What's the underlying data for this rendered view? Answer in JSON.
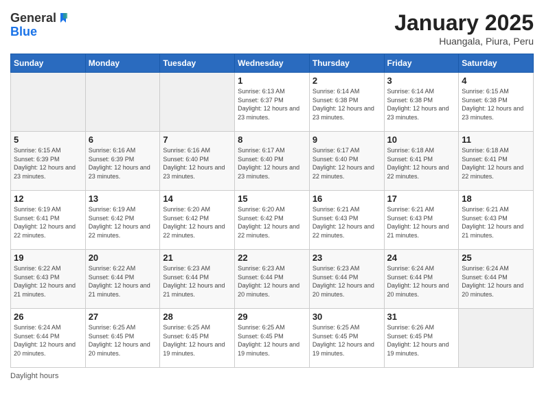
{
  "header": {
    "logo_general": "General",
    "logo_blue": "Blue",
    "title": "January 2025",
    "location": "Huangala, Piura, Peru"
  },
  "days_of_week": [
    "Sunday",
    "Monday",
    "Tuesday",
    "Wednesday",
    "Thursday",
    "Friday",
    "Saturday"
  ],
  "weeks": [
    [
      {
        "day": null,
        "sunrise": null,
        "sunset": null,
        "daylight": null
      },
      {
        "day": null,
        "sunrise": null,
        "sunset": null,
        "daylight": null
      },
      {
        "day": null,
        "sunrise": null,
        "sunset": null,
        "daylight": null
      },
      {
        "day": "1",
        "sunrise": "6:13 AM",
        "sunset": "6:37 PM",
        "daylight": "12 hours and 23 minutes."
      },
      {
        "day": "2",
        "sunrise": "6:14 AM",
        "sunset": "6:38 PM",
        "daylight": "12 hours and 23 minutes."
      },
      {
        "day": "3",
        "sunrise": "6:14 AM",
        "sunset": "6:38 PM",
        "daylight": "12 hours and 23 minutes."
      },
      {
        "day": "4",
        "sunrise": "6:15 AM",
        "sunset": "6:38 PM",
        "daylight": "12 hours and 23 minutes."
      }
    ],
    [
      {
        "day": "5",
        "sunrise": "6:15 AM",
        "sunset": "6:39 PM",
        "daylight": "12 hours and 23 minutes."
      },
      {
        "day": "6",
        "sunrise": "6:16 AM",
        "sunset": "6:39 PM",
        "daylight": "12 hours and 23 minutes."
      },
      {
        "day": "7",
        "sunrise": "6:16 AM",
        "sunset": "6:40 PM",
        "daylight": "12 hours and 23 minutes."
      },
      {
        "day": "8",
        "sunrise": "6:17 AM",
        "sunset": "6:40 PM",
        "daylight": "12 hours and 23 minutes."
      },
      {
        "day": "9",
        "sunrise": "6:17 AM",
        "sunset": "6:40 PM",
        "daylight": "12 hours and 22 minutes."
      },
      {
        "day": "10",
        "sunrise": "6:18 AM",
        "sunset": "6:41 PM",
        "daylight": "12 hours and 22 minutes."
      },
      {
        "day": "11",
        "sunrise": "6:18 AM",
        "sunset": "6:41 PM",
        "daylight": "12 hours and 22 minutes."
      }
    ],
    [
      {
        "day": "12",
        "sunrise": "6:19 AM",
        "sunset": "6:41 PM",
        "daylight": "12 hours and 22 minutes."
      },
      {
        "day": "13",
        "sunrise": "6:19 AM",
        "sunset": "6:42 PM",
        "daylight": "12 hours and 22 minutes."
      },
      {
        "day": "14",
        "sunrise": "6:20 AM",
        "sunset": "6:42 PM",
        "daylight": "12 hours and 22 minutes."
      },
      {
        "day": "15",
        "sunrise": "6:20 AM",
        "sunset": "6:42 PM",
        "daylight": "12 hours and 22 minutes."
      },
      {
        "day": "16",
        "sunrise": "6:21 AM",
        "sunset": "6:43 PM",
        "daylight": "12 hours and 22 minutes."
      },
      {
        "day": "17",
        "sunrise": "6:21 AM",
        "sunset": "6:43 PM",
        "daylight": "12 hours and 21 minutes."
      },
      {
        "day": "18",
        "sunrise": "6:21 AM",
        "sunset": "6:43 PM",
        "daylight": "12 hours and 21 minutes."
      }
    ],
    [
      {
        "day": "19",
        "sunrise": "6:22 AM",
        "sunset": "6:43 PM",
        "daylight": "12 hours and 21 minutes."
      },
      {
        "day": "20",
        "sunrise": "6:22 AM",
        "sunset": "6:44 PM",
        "daylight": "12 hours and 21 minutes."
      },
      {
        "day": "21",
        "sunrise": "6:23 AM",
        "sunset": "6:44 PM",
        "daylight": "12 hours and 21 minutes."
      },
      {
        "day": "22",
        "sunrise": "6:23 AM",
        "sunset": "6:44 PM",
        "daylight": "12 hours and 20 minutes."
      },
      {
        "day": "23",
        "sunrise": "6:23 AM",
        "sunset": "6:44 PM",
        "daylight": "12 hours and 20 minutes."
      },
      {
        "day": "24",
        "sunrise": "6:24 AM",
        "sunset": "6:44 PM",
        "daylight": "12 hours and 20 minutes."
      },
      {
        "day": "25",
        "sunrise": "6:24 AM",
        "sunset": "6:44 PM",
        "daylight": "12 hours and 20 minutes."
      }
    ],
    [
      {
        "day": "26",
        "sunrise": "6:24 AM",
        "sunset": "6:44 PM",
        "daylight": "12 hours and 20 minutes."
      },
      {
        "day": "27",
        "sunrise": "6:25 AM",
        "sunset": "6:45 PM",
        "daylight": "12 hours and 20 minutes."
      },
      {
        "day": "28",
        "sunrise": "6:25 AM",
        "sunset": "6:45 PM",
        "daylight": "12 hours and 19 minutes."
      },
      {
        "day": "29",
        "sunrise": "6:25 AM",
        "sunset": "6:45 PM",
        "daylight": "12 hours and 19 minutes."
      },
      {
        "day": "30",
        "sunrise": "6:25 AM",
        "sunset": "6:45 PM",
        "daylight": "12 hours and 19 minutes."
      },
      {
        "day": "31",
        "sunrise": "6:26 AM",
        "sunset": "6:45 PM",
        "daylight": "12 hours and 19 minutes."
      },
      {
        "day": null,
        "sunrise": null,
        "sunset": null,
        "daylight": null
      }
    ]
  ],
  "footer": {
    "daylight_label": "Daylight hours"
  }
}
